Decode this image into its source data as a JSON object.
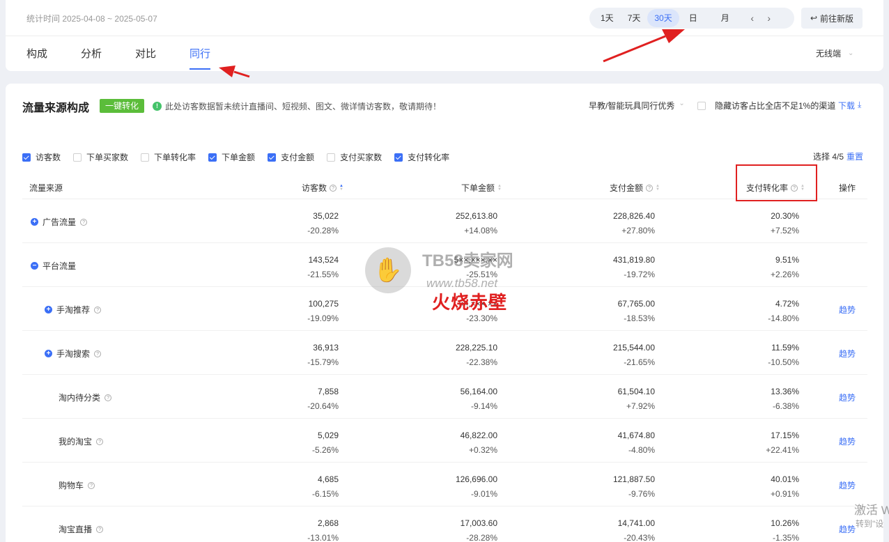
{
  "header": {
    "stat_range": "统计时间 2025-04-08 ~ 2025-05-07",
    "periods": [
      "1天",
      "7天",
      "30天",
      "日",
      "月"
    ],
    "active_period": "30天",
    "prev_arrow": "‹",
    "next_arrow": "›",
    "new_version": "前往新版",
    "tabs": [
      "构成",
      "分析",
      "对比",
      "同行"
    ],
    "active_tab": "同行",
    "terminal": "无线端"
  },
  "section": {
    "title": "流量来源构成",
    "convert_button": "一键转化",
    "notice": "此处访客数据暂未统计直播间、短视频、图文、微详情访客数，敬请期待！",
    "industry": "早教/智能玩具同行优秀",
    "hide_option": "隐藏访客占比全店不足1%的渠道",
    "download": "下载"
  },
  "metrics": [
    {
      "label": "访客数",
      "checked": true
    },
    {
      "label": "下单买家数",
      "checked": false
    },
    {
      "label": "下单转化率",
      "checked": false
    },
    {
      "label": "下单金额",
      "checked": true
    },
    {
      "label": "支付金额",
      "checked": true
    },
    {
      "label": "支付买家数",
      "checked": false
    },
    {
      "label": "支付转化率",
      "checked": true
    }
  ],
  "selection": {
    "text": "选择 4/5",
    "reset": "重置"
  },
  "table": {
    "headers": {
      "source": "流量来源",
      "visitors": "访客数",
      "order_amount": "下单金额",
      "pay_amount": "支付金额",
      "pay_rate": "支付转化率",
      "action": "操作"
    },
    "rows": [
      {
        "name": "广告流量",
        "expand": "+",
        "help": true,
        "visitors": "35,022",
        "visitors_chg": "-20.28%",
        "order": "252,613.80",
        "order_chg": "+14.08%",
        "pay": "228,826.40",
        "pay_chg": "+27.80%",
        "rate": "20.30%",
        "rate_chg": "+7.52%",
        "trend": ""
      },
      {
        "name": "平台流量",
        "expand": "−",
        "help": false,
        "visitors": "143,524",
        "visitors_chg": "-21.55%",
        "order": "5××,×××.××",
        "order_chg": "-25.51%",
        "pay": "431,819.80",
        "pay_chg": "-19.72%",
        "rate": "9.51%",
        "rate_chg": "+2.26%",
        "trend": ""
      },
      {
        "name": "手淘推荐",
        "expand": "+",
        "help": true,
        "visitors": "100,275",
        "visitors_chg": "-19.09%",
        "order": "××,×××.××",
        "order_chg": "-23.30%",
        "pay": "67,765.00",
        "pay_chg": "-18.53%",
        "rate": "4.72%",
        "rate_chg": "-14.80%",
        "trend": "趋势"
      },
      {
        "name": "手淘搜索",
        "expand": "+",
        "help": true,
        "visitors": "36,913",
        "visitors_chg": "-15.79%",
        "order": "228,225.10",
        "order_chg": "-22.38%",
        "pay": "215,544.00",
        "pay_chg": "-21.65%",
        "rate": "11.59%",
        "rate_chg": "-10.50%",
        "trend": "趋势"
      },
      {
        "name": "淘内待分类",
        "expand": "",
        "help": true,
        "visitors": "7,858",
        "visitors_chg": "-20.64%",
        "order": "56,164.00",
        "order_chg": "-9.14%",
        "pay": "61,504.10",
        "pay_chg": "+7.92%",
        "rate": "13.36%",
        "rate_chg": "-6.38%",
        "trend": "趋势"
      },
      {
        "name": "我的淘宝",
        "expand": "",
        "help": true,
        "visitors": "5,029",
        "visitors_chg": "-5.26%",
        "order": "46,822.00",
        "order_chg": "+0.32%",
        "pay": "41,674.80",
        "pay_chg": "-4.80%",
        "rate": "17.15%",
        "rate_chg": "+22.41%",
        "trend": "趋势"
      },
      {
        "name": "购物车",
        "expand": "",
        "help": true,
        "visitors": "4,685",
        "visitors_chg": "-6.15%",
        "order": "126,696.00",
        "order_chg": "-9.01%",
        "pay": "121,887.50",
        "pay_chg": "-9.76%",
        "rate": "40.01%",
        "rate_chg": "+0.91%",
        "trend": "趋势"
      },
      {
        "name": "淘宝直播",
        "expand": "",
        "help": true,
        "visitors": "2,868",
        "visitors_chg": "-13.01%",
        "order": "17,003.60",
        "order_chg": "-28.28%",
        "pay": "14,741.00",
        "pay_chg": "-20.43%",
        "rate": "10.26%",
        "rate_chg": "-1.35%",
        "trend": "趋势"
      }
    ]
  },
  "watermark": {
    "title": "TB58卖家网",
    "url": "www.tb58.net",
    "red_text": "火烧赤壁"
  },
  "os_overlay": {
    "activate": "激活 W",
    "activate_sub": "转到\"设"
  },
  "colors": {
    "accent": "#3b6ff6",
    "green": "#5bbd3a",
    "highlight_red": "#e02020"
  }
}
